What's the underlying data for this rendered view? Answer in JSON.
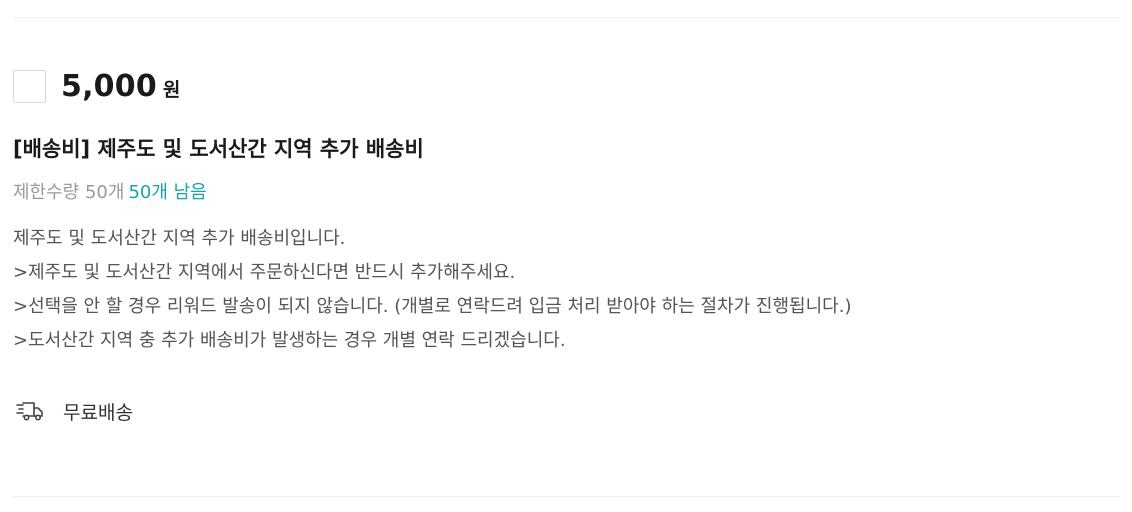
{
  "reward": {
    "price": "5,000",
    "currency_unit": "원",
    "title": "[배송비] 제주도 및 도서산간 지역 추가 배송비",
    "limit_label": "제한수량 50개",
    "remaining_label": "50개 남음",
    "description_lines": [
      "제주도 및 도서산간 지역 추가 배송비입니다.",
      ">제주도 및 도서산간 지역에서 주문하신다면 반드시 추가해주세요.",
      ">선택을 안 할 경우 리워드 발송이 되지 않습니다. (개별로 연락드려 입금 처리 받아야 하는 절차가 진행됩니다.)",
      ">도서산간 지역 충 추가 배송비가 발생하는 경우 개별 연락 드리겠습니다."
    ],
    "shipping_label": "무료배송",
    "shipping_icon": "truck-icon",
    "checkbox_checked": false
  },
  "colors": {
    "accent": "#1aa3a8",
    "muted_text": "#9a9a9a",
    "body_text": "#555555",
    "divider": "#eeeeee"
  }
}
